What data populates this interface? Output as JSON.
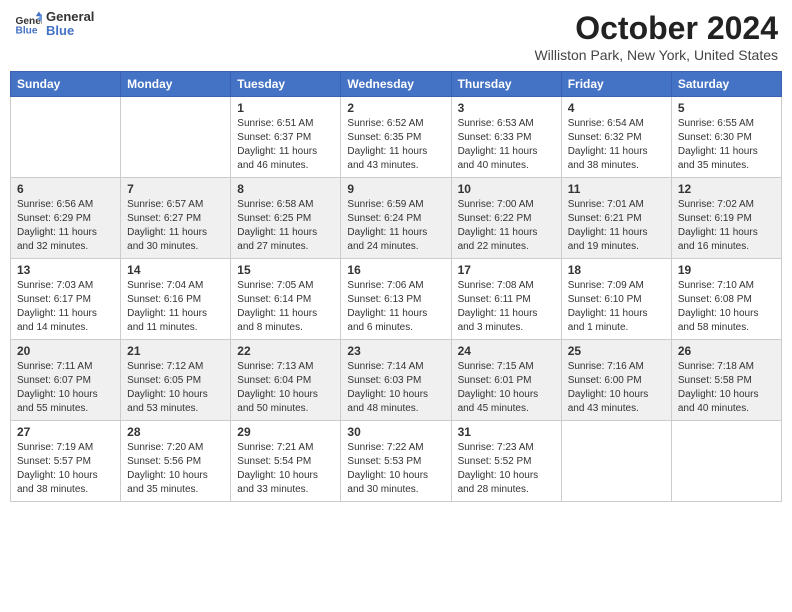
{
  "header": {
    "logo_line1": "General",
    "logo_line2": "Blue",
    "title": "October 2024",
    "subtitle": "Williston Park, New York, United States"
  },
  "days_of_week": [
    "Sunday",
    "Monday",
    "Tuesday",
    "Wednesday",
    "Thursday",
    "Friday",
    "Saturday"
  ],
  "weeks": [
    [
      {
        "day": "",
        "detail": ""
      },
      {
        "day": "",
        "detail": ""
      },
      {
        "day": "1",
        "detail": "Sunrise: 6:51 AM\nSunset: 6:37 PM\nDaylight: 11 hours and 46 minutes."
      },
      {
        "day": "2",
        "detail": "Sunrise: 6:52 AM\nSunset: 6:35 PM\nDaylight: 11 hours and 43 minutes."
      },
      {
        "day": "3",
        "detail": "Sunrise: 6:53 AM\nSunset: 6:33 PM\nDaylight: 11 hours and 40 minutes."
      },
      {
        "day": "4",
        "detail": "Sunrise: 6:54 AM\nSunset: 6:32 PM\nDaylight: 11 hours and 38 minutes."
      },
      {
        "day": "5",
        "detail": "Sunrise: 6:55 AM\nSunset: 6:30 PM\nDaylight: 11 hours and 35 minutes."
      }
    ],
    [
      {
        "day": "6",
        "detail": "Sunrise: 6:56 AM\nSunset: 6:29 PM\nDaylight: 11 hours and 32 minutes."
      },
      {
        "day": "7",
        "detail": "Sunrise: 6:57 AM\nSunset: 6:27 PM\nDaylight: 11 hours and 30 minutes."
      },
      {
        "day": "8",
        "detail": "Sunrise: 6:58 AM\nSunset: 6:25 PM\nDaylight: 11 hours and 27 minutes."
      },
      {
        "day": "9",
        "detail": "Sunrise: 6:59 AM\nSunset: 6:24 PM\nDaylight: 11 hours and 24 minutes."
      },
      {
        "day": "10",
        "detail": "Sunrise: 7:00 AM\nSunset: 6:22 PM\nDaylight: 11 hours and 22 minutes."
      },
      {
        "day": "11",
        "detail": "Sunrise: 7:01 AM\nSunset: 6:21 PM\nDaylight: 11 hours and 19 minutes."
      },
      {
        "day": "12",
        "detail": "Sunrise: 7:02 AM\nSunset: 6:19 PM\nDaylight: 11 hours and 16 minutes."
      }
    ],
    [
      {
        "day": "13",
        "detail": "Sunrise: 7:03 AM\nSunset: 6:17 PM\nDaylight: 11 hours and 14 minutes."
      },
      {
        "day": "14",
        "detail": "Sunrise: 7:04 AM\nSunset: 6:16 PM\nDaylight: 11 hours and 11 minutes."
      },
      {
        "day": "15",
        "detail": "Sunrise: 7:05 AM\nSunset: 6:14 PM\nDaylight: 11 hours and 8 minutes."
      },
      {
        "day": "16",
        "detail": "Sunrise: 7:06 AM\nSunset: 6:13 PM\nDaylight: 11 hours and 6 minutes."
      },
      {
        "day": "17",
        "detail": "Sunrise: 7:08 AM\nSunset: 6:11 PM\nDaylight: 11 hours and 3 minutes."
      },
      {
        "day": "18",
        "detail": "Sunrise: 7:09 AM\nSunset: 6:10 PM\nDaylight: 11 hours and 1 minute."
      },
      {
        "day": "19",
        "detail": "Sunrise: 7:10 AM\nSunset: 6:08 PM\nDaylight: 10 hours and 58 minutes."
      }
    ],
    [
      {
        "day": "20",
        "detail": "Sunrise: 7:11 AM\nSunset: 6:07 PM\nDaylight: 10 hours and 55 minutes."
      },
      {
        "day": "21",
        "detail": "Sunrise: 7:12 AM\nSunset: 6:05 PM\nDaylight: 10 hours and 53 minutes."
      },
      {
        "day": "22",
        "detail": "Sunrise: 7:13 AM\nSunset: 6:04 PM\nDaylight: 10 hours and 50 minutes."
      },
      {
        "day": "23",
        "detail": "Sunrise: 7:14 AM\nSunset: 6:03 PM\nDaylight: 10 hours and 48 minutes."
      },
      {
        "day": "24",
        "detail": "Sunrise: 7:15 AM\nSunset: 6:01 PM\nDaylight: 10 hours and 45 minutes."
      },
      {
        "day": "25",
        "detail": "Sunrise: 7:16 AM\nSunset: 6:00 PM\nDaylight: 10 hours and 43 minutes."
      },
      {
        "day": "26",
        "detail": "Sunrise: 7:18 AM\nSunset: 5:58 PM\nDaylight: 10 hours and 40 minutes."
      }
    ],
    [
      {
        "day": "27",
        "detail": "Sunrise: 7:19 AM\nSunset: 5:57 PM\nDaylight: 10 hours and 38 minutes."
      },
      {
        "day": "28",
        "detail": "Sunrise: 7:20 AM\nSunset: 5:56 PM\nDaylight: 10 hours and 35 minutes."
      },
      {
        "day": "29",
        "detail": "Sunrise: 7:21 AM\nSunset: 5:54 PM\nDaylight: 10 hours and 33 minutes."
      },
      {
        "day": "30",
        "detail": "Sunrise: 7:22 AM\nSunset: 5:53 PM\nDaylight: 10 hours and 30 minutes."
      },
      {
        "day": "31",
        "detail": "Sunrise: 7:23 AM\nSunset: 5:52 PM\nDaylight: 10 hours and 28 minutes."
      },
      {
        "day": "",
        "detail": ""
      },
      {
        "day": "",
        "detail": ""
      }
    ]
  ]
}
